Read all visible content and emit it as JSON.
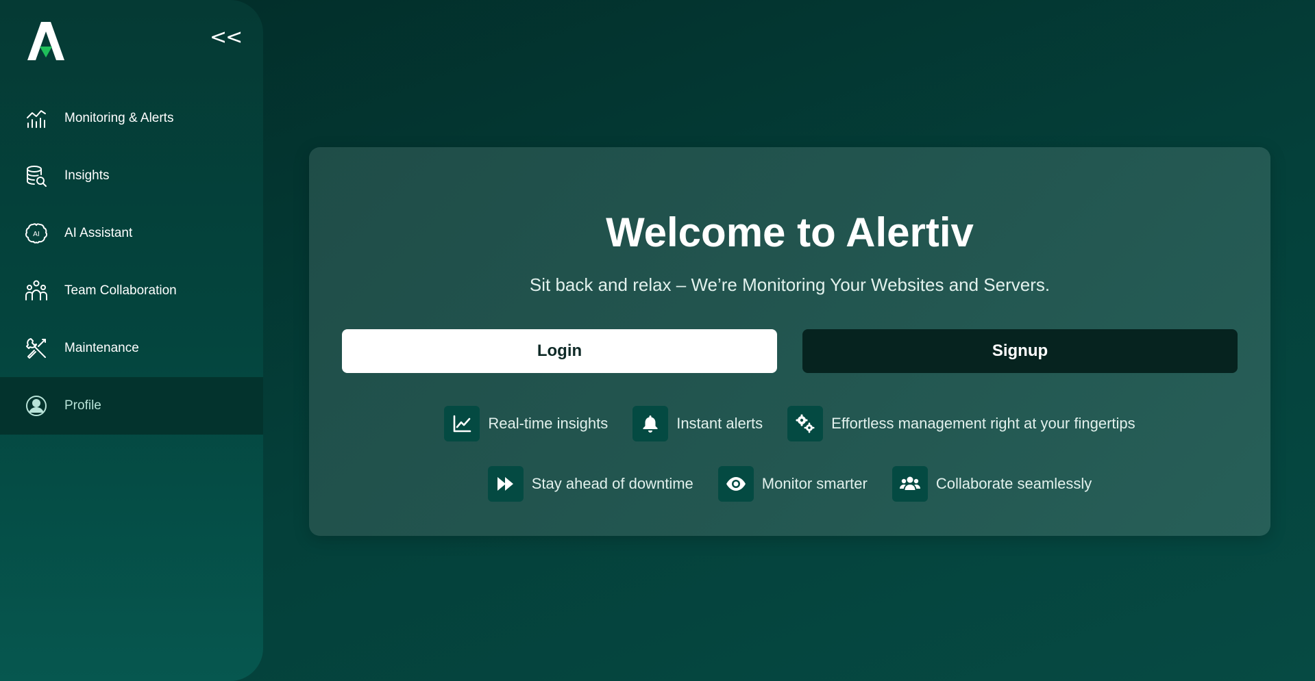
{
  "app": {
    "name": "Alertiv"
  },
  "sidebar": {
    "collapse_label": "<<",
    "items": [
      {
        "label": "Monitoring & Alerts",
        "icon": "chart-bars-icon"
      },
      {
        "label": "Insights",
        "icon": "database-search-icon"
      },
      {
        "label": "AI Assistant",
        "icon": "ai-brain-icon"
      },
      {
        "label": "Team Collaboration",
        "icon": "team-icon"
      },
      {
        "label": "Maintenance",
        "icon": "tools-icon"
      },
      {
        "label": "Profile",
        "icon": "user-circle-icon",
        "active": true
      }
    ]
  },
  "main": {
    "title": "Welcome to Alertiv",
    "subtitle": "Sit back and relax – We’re Monitoring Your Websites and Servers.",
    "login_label": "Login",
    "signup_label": "Signup",
    "features": [
      {
        "label": "Real-time insights",
        "icon": "line-chart-icon"
      },
      {
        "label": "Instant alerts",
        "icon": "bell-icon"
      },
      {
        "label": "Effortless management right at your fingertips",
        "icon": "gears-icon"
      },
      {
        "label": "Stay ahead of downtime",
        "icon": "fast-forward-icon"
      },
      {
        "label": "Monitor smarter",
        "icon": "eye-icon"
      },
      {
        "label": "Collaborate seamlessly",
        "icon": "users-icon"
      }
    ]
  },
  "colors": {
    "background": "#04403a",
    "sidebar": "#053a34",
    "sidebar_active": "#03332d",
    "card": "#235751",
    "signup_button": "#06231f",
    "icon_tile": "#044a42",
    "logo_accent": "#1fbf5a"
  }
}
